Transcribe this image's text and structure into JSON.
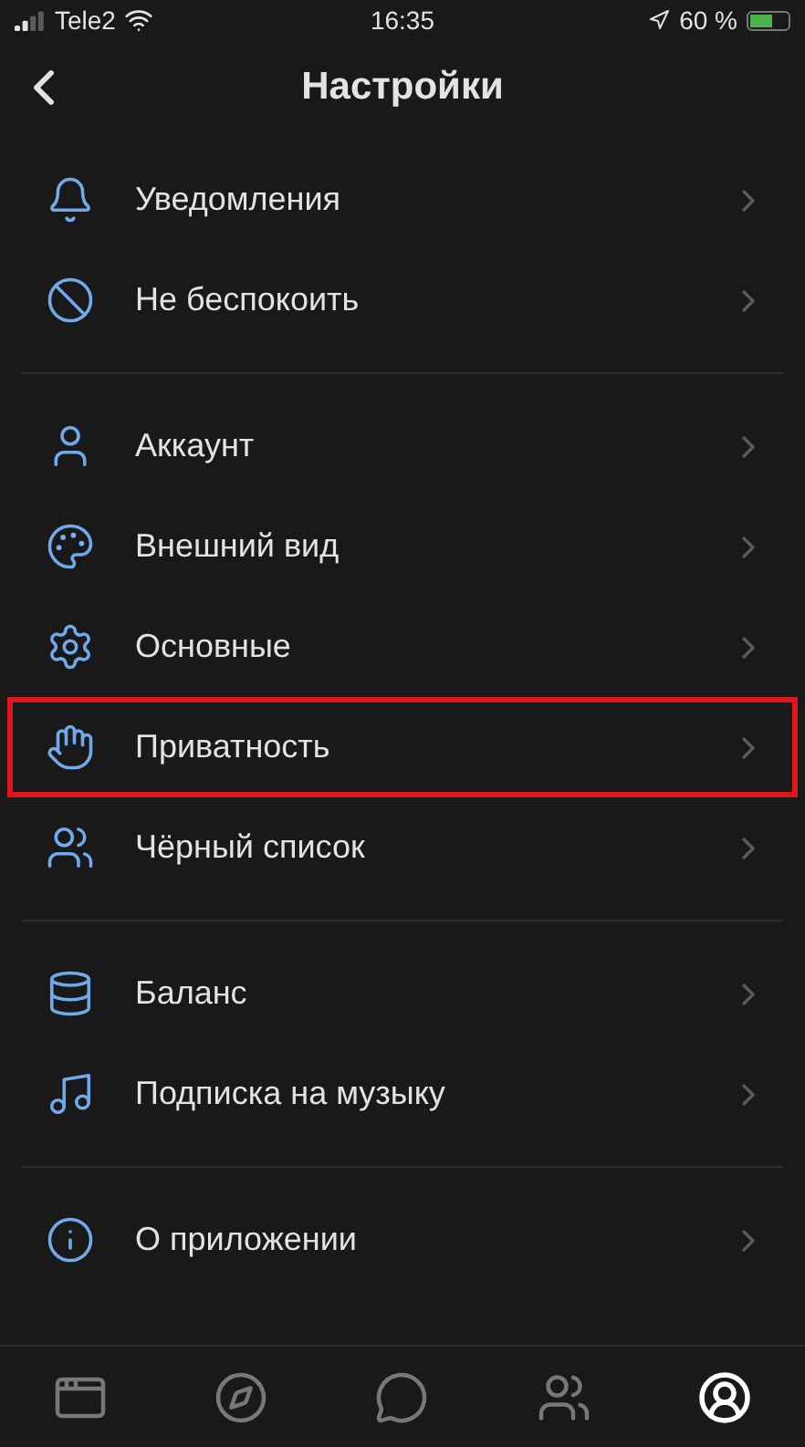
{
  "status_bar": {
    "carrier": "Tele2",
    "time": "16:35",
    "battery": "60 %"
  },
  "header": {
    "title": "Настройки"
  },
  "sections": [
    {
      "items": [
        {
          "kind": "bell",
          "label": "Уведомления",
          "highlighted": false
        },
        {
          "kind": "ban",
          "label": "Не беспокоить",
          "highlighted": false
        }
      ]
    },
    {
      "items": [
        {
          "kind": "user",
          "label": "Аккаунт",
          "highlighted": false
        },
        {
          "kind": "palette",
          "label": "Внешний вид",
          "highlighted": false
        },
        {
          "kind": "gear",
          "label": "Основные",
          "highlighted": false
        },
        {
          "kind": "hand",
          "label": "Приватность",
          "highlighted": true
        },
        {
          "kind": "users",
          "label": "Чёрный список",
          "highlighted": false
        }
      ]
    },
    {
      "items": [
        {
          "kind": "database",
          "label": "Баланс",
          "highlighted": false
        },
        {
          "kind": "music",
          "label": "Подписка на музыку",
          "highlighted": false
        }
      ]
    },
    {
      "items": [
        {
          "kind": "info",
          "label": "О приложении",
          "highlighted": false
        }
      ]
    }
  ],
  "tab_bar": [
    {
      "kind": "window",
      "selected": false
    },
    {
      "kind": "compass",
      "selected": false
    },
    {
      "kind": "chat",
      "selected": false
    },
    {
      "kind": "users",
      "selected": false
    },
    {
      "kind": "profile",
      "selected": true
    }
  ]
}
